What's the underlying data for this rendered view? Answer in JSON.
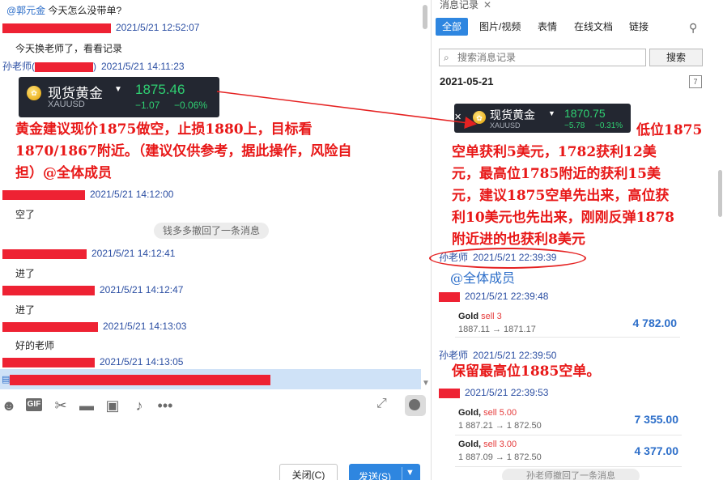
{
  "colors": {
    "accent_blue": "#2e86e0",
    "name_blue": "#2c4fa3",
    "annotation_red": "#e81818",
    "redaction_red": "#ee2233",
    "gold_green": "#2fd072",
    "gold_card_bg": "#232731",
    "trade_red": "#e53b3b",
    "trade_value_blue": "#2c6ec9"
  },
  "chat": {
    "quote": {
      "mention": "@郭元金",
      "text": "今天怎么没带单?"
    },
    "messages": [
      {
        "time": "2021/5/21 12:52:07",
        "text": "今天换老师了，看看记录"
      },
      {
        "sender_prefix": "孙老师(",
        "sender_suffix": ")",
        "time": "2021/5/21 14:11:23"
      },
      {
        "time": "2021/5/21 14:12:00",
        "text": "空了"
      },
      {
        "time": "2021/5/21 14:12:41",
        "text": "进了"
      },
      {
        "time": "2021/5/21 14:12:47",
        "text": "进了"
      },
      {
        "time": "2021/5/21 14:13:03",
        "text": "好的老师"
      },
      {
        "time": "2021/5/21 14:13:05"
      }
    ],
    "gold_quote": {
      "title": "现货黄金",
      "symbol": "XAUUSD",
      "price": "1875.46",
      "change": "−1.07",
      "change_pct": "−0.06%"
    },
    "annotation": "黄金建议现价1875做空，止损1880上，目标看\n1870/1867附近。（建议仅供参考，据此操作，风险自\n担）@全体成员",
    "recall_notice": "钱多多撤回了一条消息",
    "toolbar_icons": [
      "emoji-icon",
      "gif-icon",
      "scissors-icon",
      "folder-icon",
      "image-icon",
      "bell-icon",
      "more-icon"
    ],
    "gif_label": "GIF",
    "close_button": "关闭(C)",
    "send_button": "发送(S)"
  },
  "history": {
    "tab_label": "消息记录",
    "tabs": [
      "全部",
      "图片/视频",
      "表情",
      "在线文档",
      "链接"
    ],
    "search_placeholder": "搜索消息记录",
    "search_button": "搜索",
    "date": "2021-05-21",
    "gold_quote": {
      "title": "现货黄金",
      "symbol": "XAUUSD",
      "price": "1870.75",
      "change": "−5.78",
      "change_pct": "−0.31%"
    },
    "annotation": "低位1875\n空单获利5美元，1782获利12美\n元，最高位1785附近的获利15美\n元，建议1875空单先出来，高位获\n利10美元也先出来，刚刚反弹1878\n附近进的也获利8美元",
    "msg1": {
      "sender": "孙老师",
      "time": "2021/5/21 22:39:39",
      "text": "@全体成员"
    },
    "msg2": {
      "time": "2021/5/21 22:39:48"
    },
    "trade1": {
      "asset": "Gold",
      "side": "sell 3",
      "prices": "1887.11 → 1871.17",
      "value": "4 782.00"
    },
    "msg3": {
      "sender": "孙老师",
      "time": "2021/5/21 22:39:50",
      "text": "保留最高位1885空单。"
    },
    "msg4": {
      "time": "2021/5/21 22:39:53"
    },
    "trade2": {
      "asset": "Gold,",
      "side": "sell 5.00",
      "prices": "1 887.21 → 1 872.50",
      "value": "7 355.00"
    },
    "trade3": {
      "asset": "Gold,",
      "side": "sell 3.00",
      "prices": "1 887.09 → 1 872.50",
      "value": "4 377.00"
    },
    "recall_notice_partial": "孙老师撤回了一条消息"
  }
}
